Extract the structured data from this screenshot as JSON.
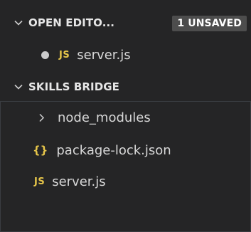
{
  "open_editors": {
    "title": "OPEN EDITO...",
    "badge": "1 UNSAVED",
    "files": [
      {
        "icon": "JS",
        "name": "server.js",
        "unsaved": true
      }
    ]
  },
  "project": {
    "title": "SKILLS BRIDGE",
    "items": [
      {
        "type": "folder",
        "name": "node_modules"
      },
      {
        "type": "file",
        "icon": "{}",
        "name": "package-lock.json"
      },
      {
        "type": "file",
        "icon": "JS",
        "name": "server.js"
      }
    ]
  },
  "colors": {
    "background": "#252526",
    "badge_background": "#4d4d4d",
    "file_icon": "#e7c64a",
    "text": "#cccccc"
  }
}
